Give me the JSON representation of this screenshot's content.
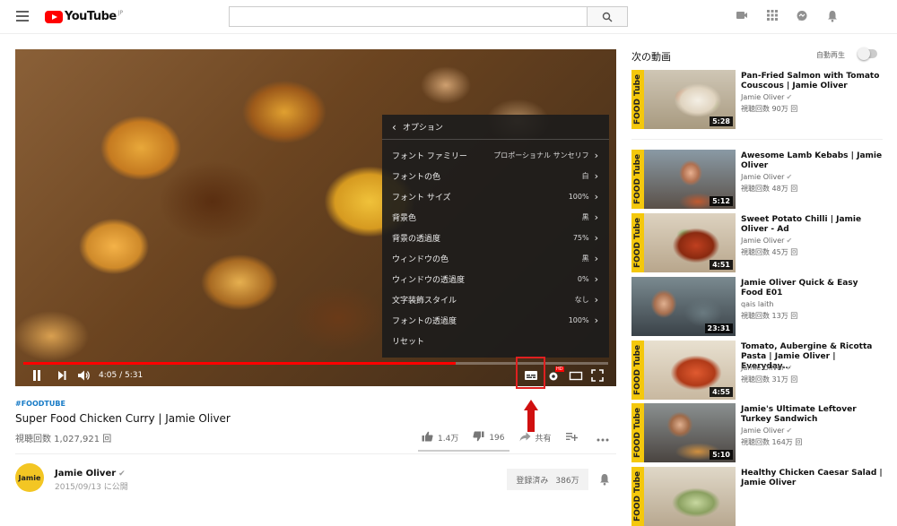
{
  "header": {
    "logo_text": "YouTube",
    "region": "JP",
    "search_placeholder": "",
    "icons": [
      "menu-icon",
      "search-icon",
      "video-camera-icon",
      "apps-grid-icon",
      "messages-icon",
      "bell-icon"
    ]
  },
  "player": {
    "time": "4:05 / 5:31",
    "progress_fraction": 0.74,
    "settings_menu": {
      "title": "オプション",
      "rows": [
        {
          "label": "フォント ファミリー",
          "value": "プロポーショナル サンセリフ"
        },
        {
          "label": "フォントの色",
          "value": "白"
        },
        {
          "label": "フォント サイズ",
          "value": "100%"
        },
        {
          "label": "背景色",
          "value": "黒"
        },
        {
          "label": "背景の透過度",
          "value": "75%"
        },
        {
          "label": "ウィンドウの色",
          "value": "黒"
        },
        {
          "label": "ウィンドウの透過度",
          "value": "0%"
        },
        {
          "label": "文字装飾スタイル",
          "value": "なし"
        },
        {
          "label": "フォントの透過度",
          "value": "100%"
        },
        {
          "label": "リセット",
          "value": ""
        }
      ]
    },
    "quality_badge": "HD"
  },
  "video": {
    "hashtag": "#FOODTUBE",
    "title": "Super Food Chicken Curry | Jamie Oliver",
    "views": "視聴回数 1,027,921 回",
    "likes": "1.4万",
    "dislikes": "196",
    "share_label": "共有"
  },
  "channel": {
    "avatar_text": "Jamie",
    "name": "Jamie Oliver",
    "published": "2015/09/13 に公開",
    "subscribe_label": "登録済み",
    "subscriber_count": "386万"
  },
  "sidebar": {
    "up_next": "次の動画",
    "autoplay_label": "自動再生",
    "autoplay_on": false,
    "band_text": "FOOD Tube",
    "videos": [
      {
        "title": "Pan-Fried Salmon with Tomato Couscous | Jamie Oliver",
        "channel": "Jamie Oliver",
        "verified": true,
        "views": "視聴回数 90万 回",
        "duration": "5:28",
        "branded": true
      },
      {
        "title": "Awesome Lamb Kebabs | Jamie Oliver",
        "channel": "Jamie Oliver",
        "verified": true,
        "views": "視聴回数 48万 回",
        "duration": "5:12",
        "branded": true
      },
      {
        "title": "Sweet Potato Chilli | Jamie Oliver - Ad",
        "channel": "Jamie Oliver",
        "verified": true,
        "views": "視聴回数 45万 回",
        "duration": "4:51",
        "branded": true
      },
      {
        "title": "Jamie Oliver Quick & Easy Food E01",
        "channel": "qais laith",
        "verified": false,
        "views": "視聴回数 13万 回",
        "duration": "23:31",
        "branded": false
      },
      {
        "title": "Tomato, Aubergine & Ricotta Pasta | Jamie Oliver | Everyday…",
        "channel": "Jamie Oliver",
        "verified": true,
        "views": "視聴回数 31万 回",
        "duration": "4:55",
        "branded": true
      },
      {
        "title": "Jamie's Ultimate Leftover Turkey Sandwich",
        "channel": "Jamie Oliver",
        "verified": true,
        "views": "視聴回数 164万 回",
        "duration": "5:10",
        "branded": true
      },
      {
        "title": "Healthy Chicken Caesar Salad | Jamie Oliver",
        "channel": "",
        "verified": false,
        "views": "",
        "duration": "",
        "branded": true
      }
    ]
  },
  "colors": {
    "accent": "#ff0000",
    "highlight_box": "#e02020",
    "link": "#167ac6"
  }
}
